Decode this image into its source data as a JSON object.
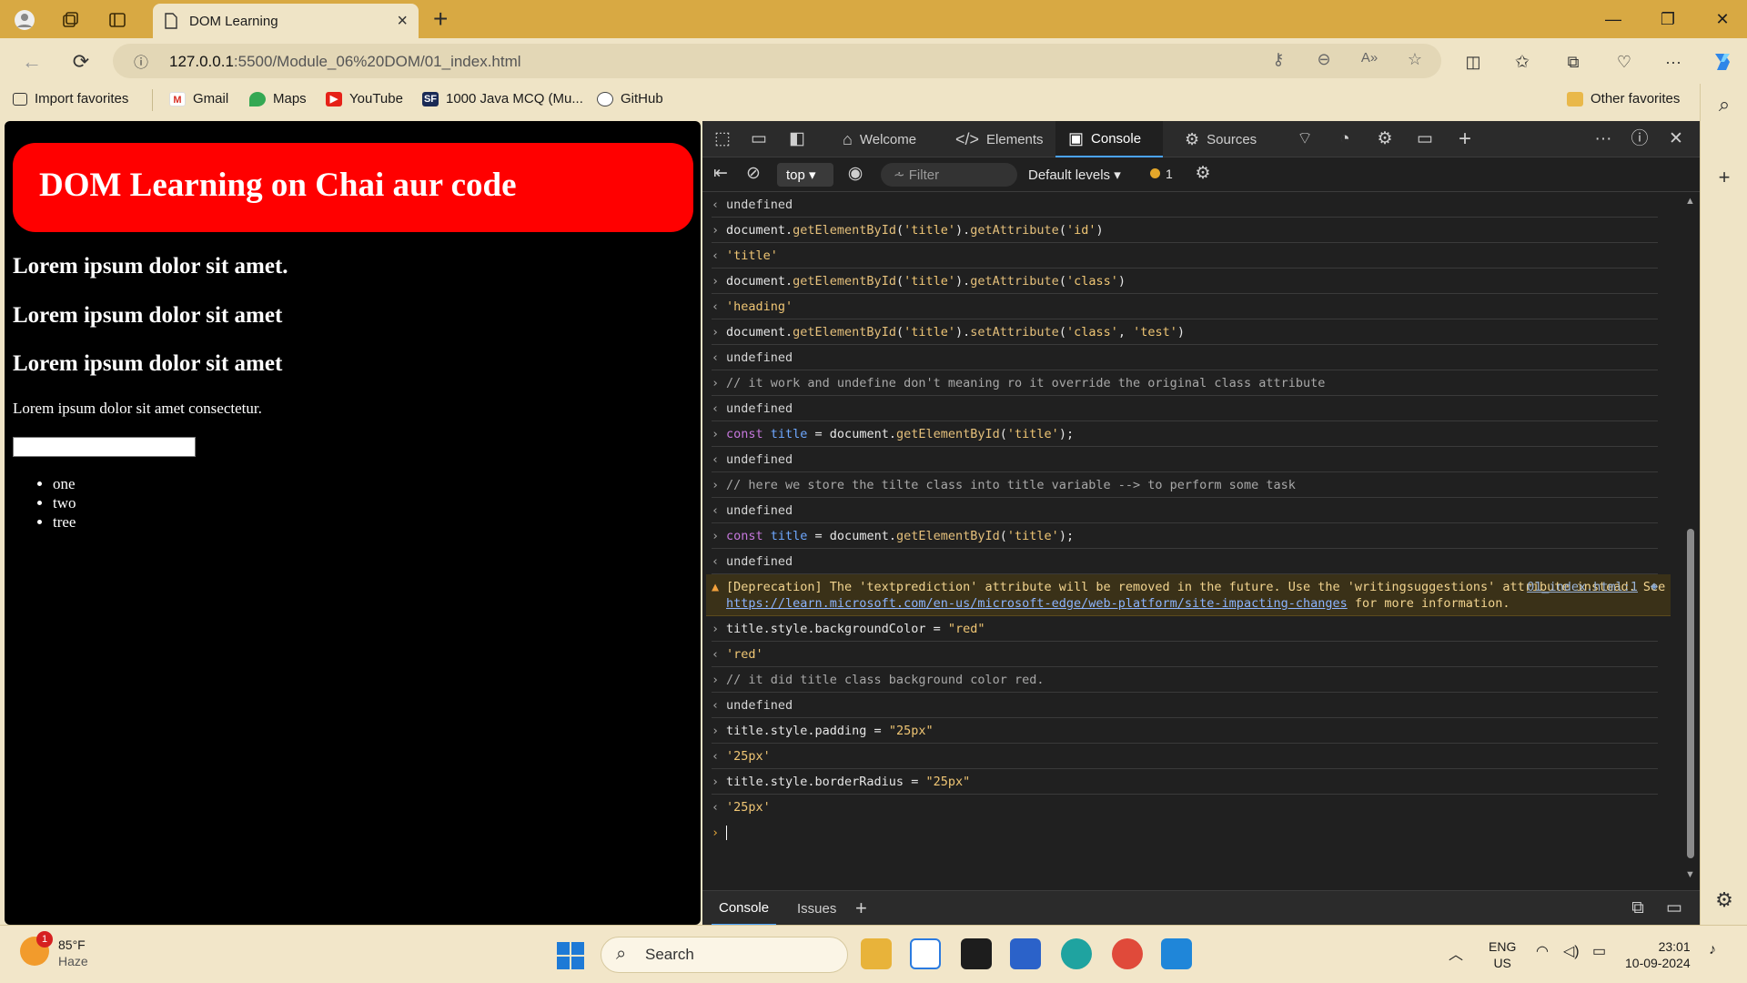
{
  "browser": {
    "tab_title": "DOM Learning",
    "url_host": "127.0.0.1",
    "url_path": ":5500/Module_06%20DOM/01_index.html",
    "favorites": [
      "Import favorites",
      "Gmail",
      "Maps",
      "YouTube",
      "1000 Java MCQ (Mu...",
      "GitHub"
    ],
    "other_favorites": "Other favorites"
  },
  "page": {
    "title": "DOM Learning on Chai aur code",
    "headings": [
      "Lorem ipsum dolor sit amet.",
      "Lorem ipsum dolor sit amet",
      "Lorem ipsum dolor sit amet"
    ],
    "paragraph": "Lorem ipsum dolor sit amet consectetur.",
    "list": [
      "one",
      "two",
      "tree"
    ]
  },
  "devtools": {
    "tabs": [
      "Welcome",
      "Elements",
      "Console",
      "Sources"
    ],
    "context": "top",
    "filter_placeholder": "Filter",
    "levels": "Default levels",
    "issues_count": "1",
    "warning": {
      "text": "[Deprecation] The 'textprediction' attribute will be removed in the future. Use the 'writingsuggestions' attribute instead. See",
      "link": "https://learn.microsoft.com/en-us/microsoft-edge/web-platform/site-impacting-changes",
      "suffix": "for more information.",
      "source": "01_index.html:1"
    },
    "drawer_tabs": [
      "Console",
      "Issues"
    ]
  },
  "taskbar": {
    "temp": "85°F",
    "condition": "Haze",
    "weather_badge": "1",
    "search": "Search",
    "lang1": "ENG",
    "lang2": "US",
    "time": "23:01",
    "date": "10-09-2024"
  }
}
